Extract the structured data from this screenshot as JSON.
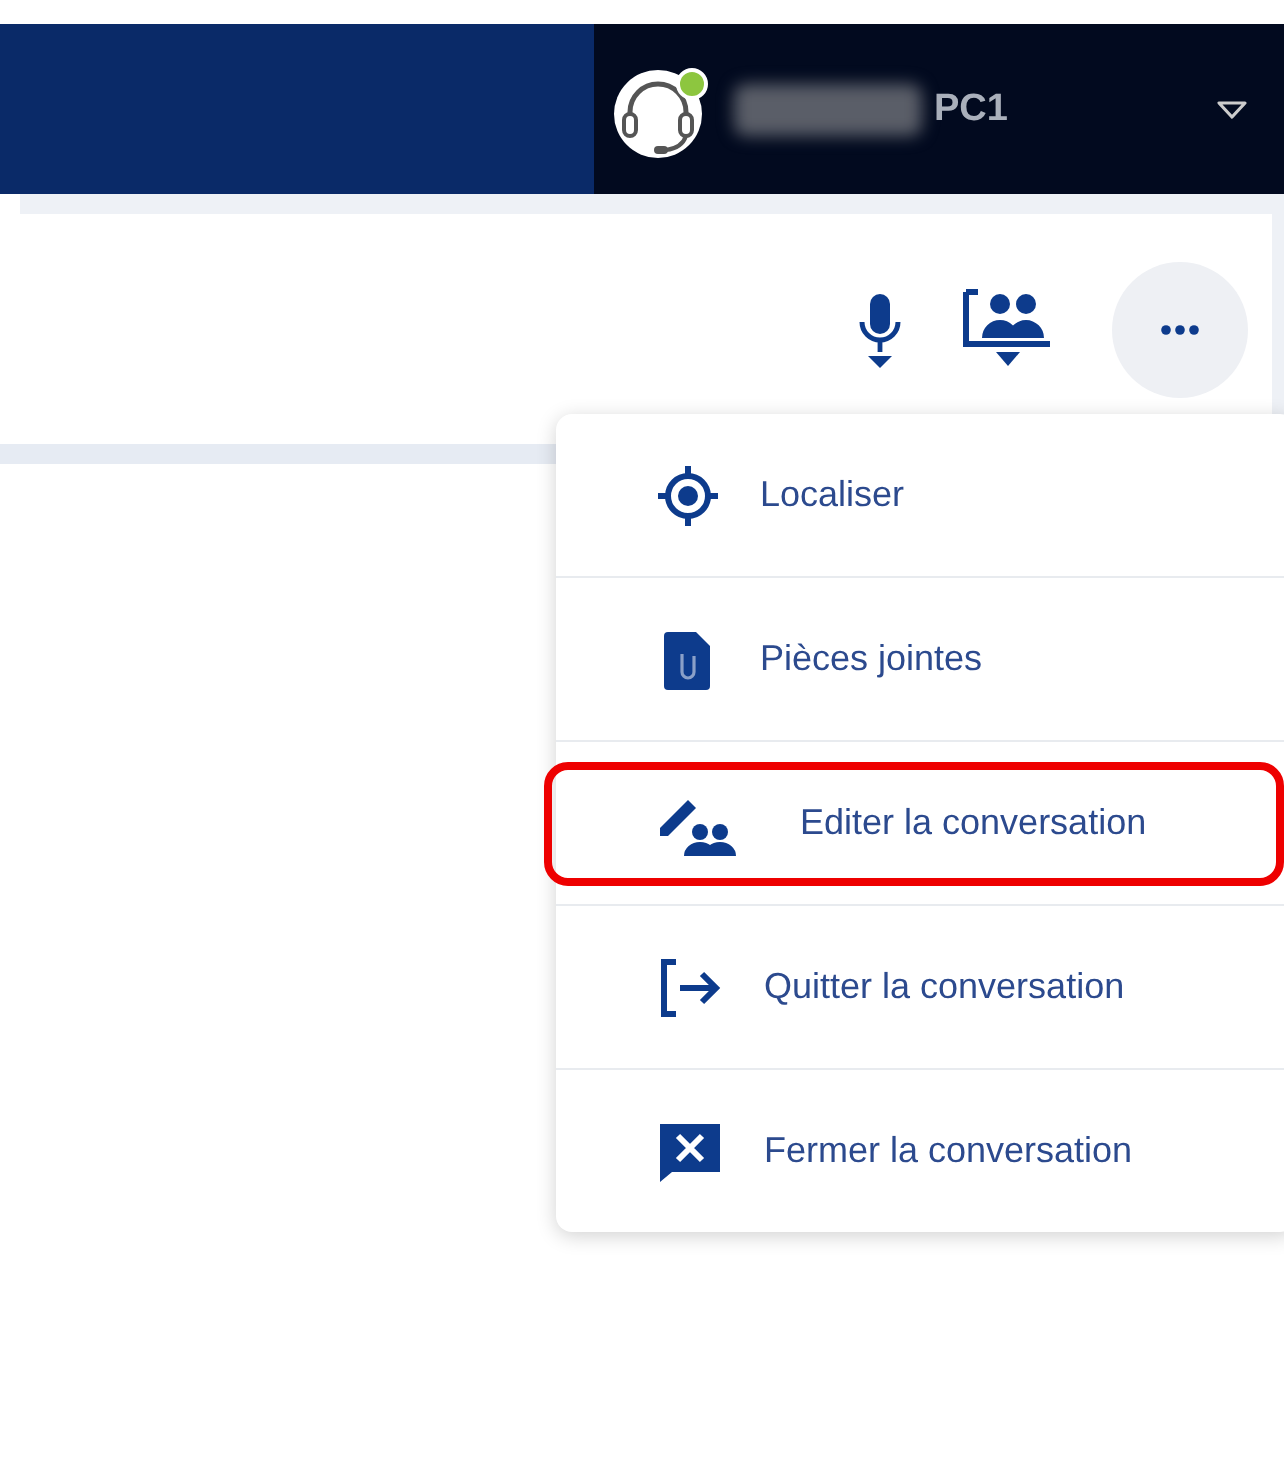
{
  "user": {
    "name_suffix": "PC1"
  },
  "menu": [
    {
      "label": "Localiser",
      "highlighted": false
    },
    {
      "label": "Pièces jointes",
      "highlighted": false
    },
    {
      "label": "Editer la conversation",
      "highlighted": true
    },
    {
      "label": "Quitter la conversation",
      "highlighted": false
    },
    {
      "label": "Fermer la conversation",
      "highlighted": false
    }
  ]
}
